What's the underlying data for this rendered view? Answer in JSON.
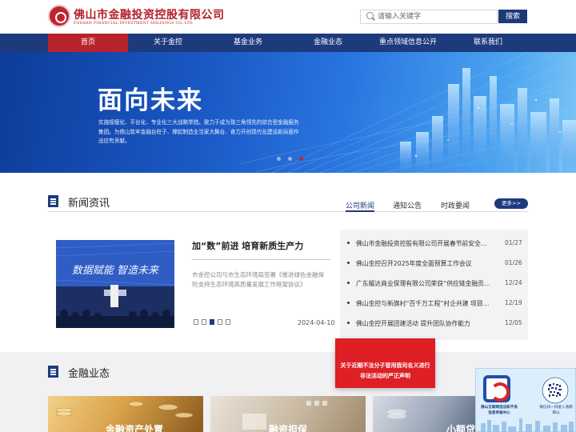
{
  "header": {
    "company_name_cn": "佛山市金融投资控股有限公司",
    "company_name_en": "FOSHAN FINANCIAL INVESTMENT HOLDINGS CO.,LTD",
    "search_placeholder": "请输入关键字",
    "search_button": "搜索"
  },
  "nav": {
    "items": [
      {
        "label": "首页",
        "active": true
      },
      {
        "label": "关于金控",
        "active": false
      },
      {
        "label": "基金业务",
        "active": false
      },
      {
        "label": "金融业态",
        "active": false
      },
      {
        "label": "重点领域信息公开",
        "active": false
      },
      {
        "label": "联系我们",
        "active": false
      }
    ]
  },
  "banner": {
    "headline": "面向未来",
    "description": "实施规模化、平台化、专业化三大战略举措。致力于成为珠三角领先的综合型金融服务集团。为佛山筑牢金融台柱子、撑起制造业当家大舞台、奋力开创现代化建设新局面作出应有贡献。",
    "active_slide": 3,
    "slide_count": 3
  },
  "news": {
    "section_title": "新闻资讯",
    "tabs": [
      "公司新闻",
      "通知公告",
      "时政要闻"
    ],
    "active_tab": "公司新闻",
    "more_label": "更多>>",
    "featured": {
      "image_text": "数据赋能 智造未来",
      "title": "加“数”前进 培育新质生产力",
      "summary": "市金控公司与市生态环境局签署《推进绿色金融保险支持生态环境高质量发展工作框架协议》",
      "date": "2024-04-10",
      "pager_count": 5,
      "pager_active": 3
    },
    "items": [
      {
        "title": "佛山市金融投资控股有限公司开展春节前安全检查",
        "date": "01/27"
      },
      {
        "title": "佛山金控召开2025年度全面预算工作会议",
        "date": "01/26"
      },
      {
        "title": "广东耀达商业保理有限公司荣获“供应链金融贡献奖”",
        "date": "12/24"
      },
      {
        "title": "佛山金控与新旗村“百千万工程”村企共建 项目签约",
        "date": "12/19"
      },
      {
        "title": "佛山金控开展团建活动 提升团队协作能力",
        "date": "12/05"
      }
    ]
  },
  "finance": {
    "section_title": "金融业态",
    "cards": [
      "金融资产处置",
      "融资担保",
      "小额贷款"
    ]
  },
  "notice": {
    "text": "关于近期不法分子冒用我司名义进行非法活动的严正声明"
  },
  "qr_panel": {
    "left_caption": "佛山互联网违法和不良信息举报中心",
    "right_caption": "微信扫一扫进入清朗佛山"
  },
  "colors": {
    "brand_navy": "#1d3a7d",
    "brand_red": "#b8232b",
    "notice_red": "#de1f26",
    "banner_blue": "#1a58c4"
  }
}
